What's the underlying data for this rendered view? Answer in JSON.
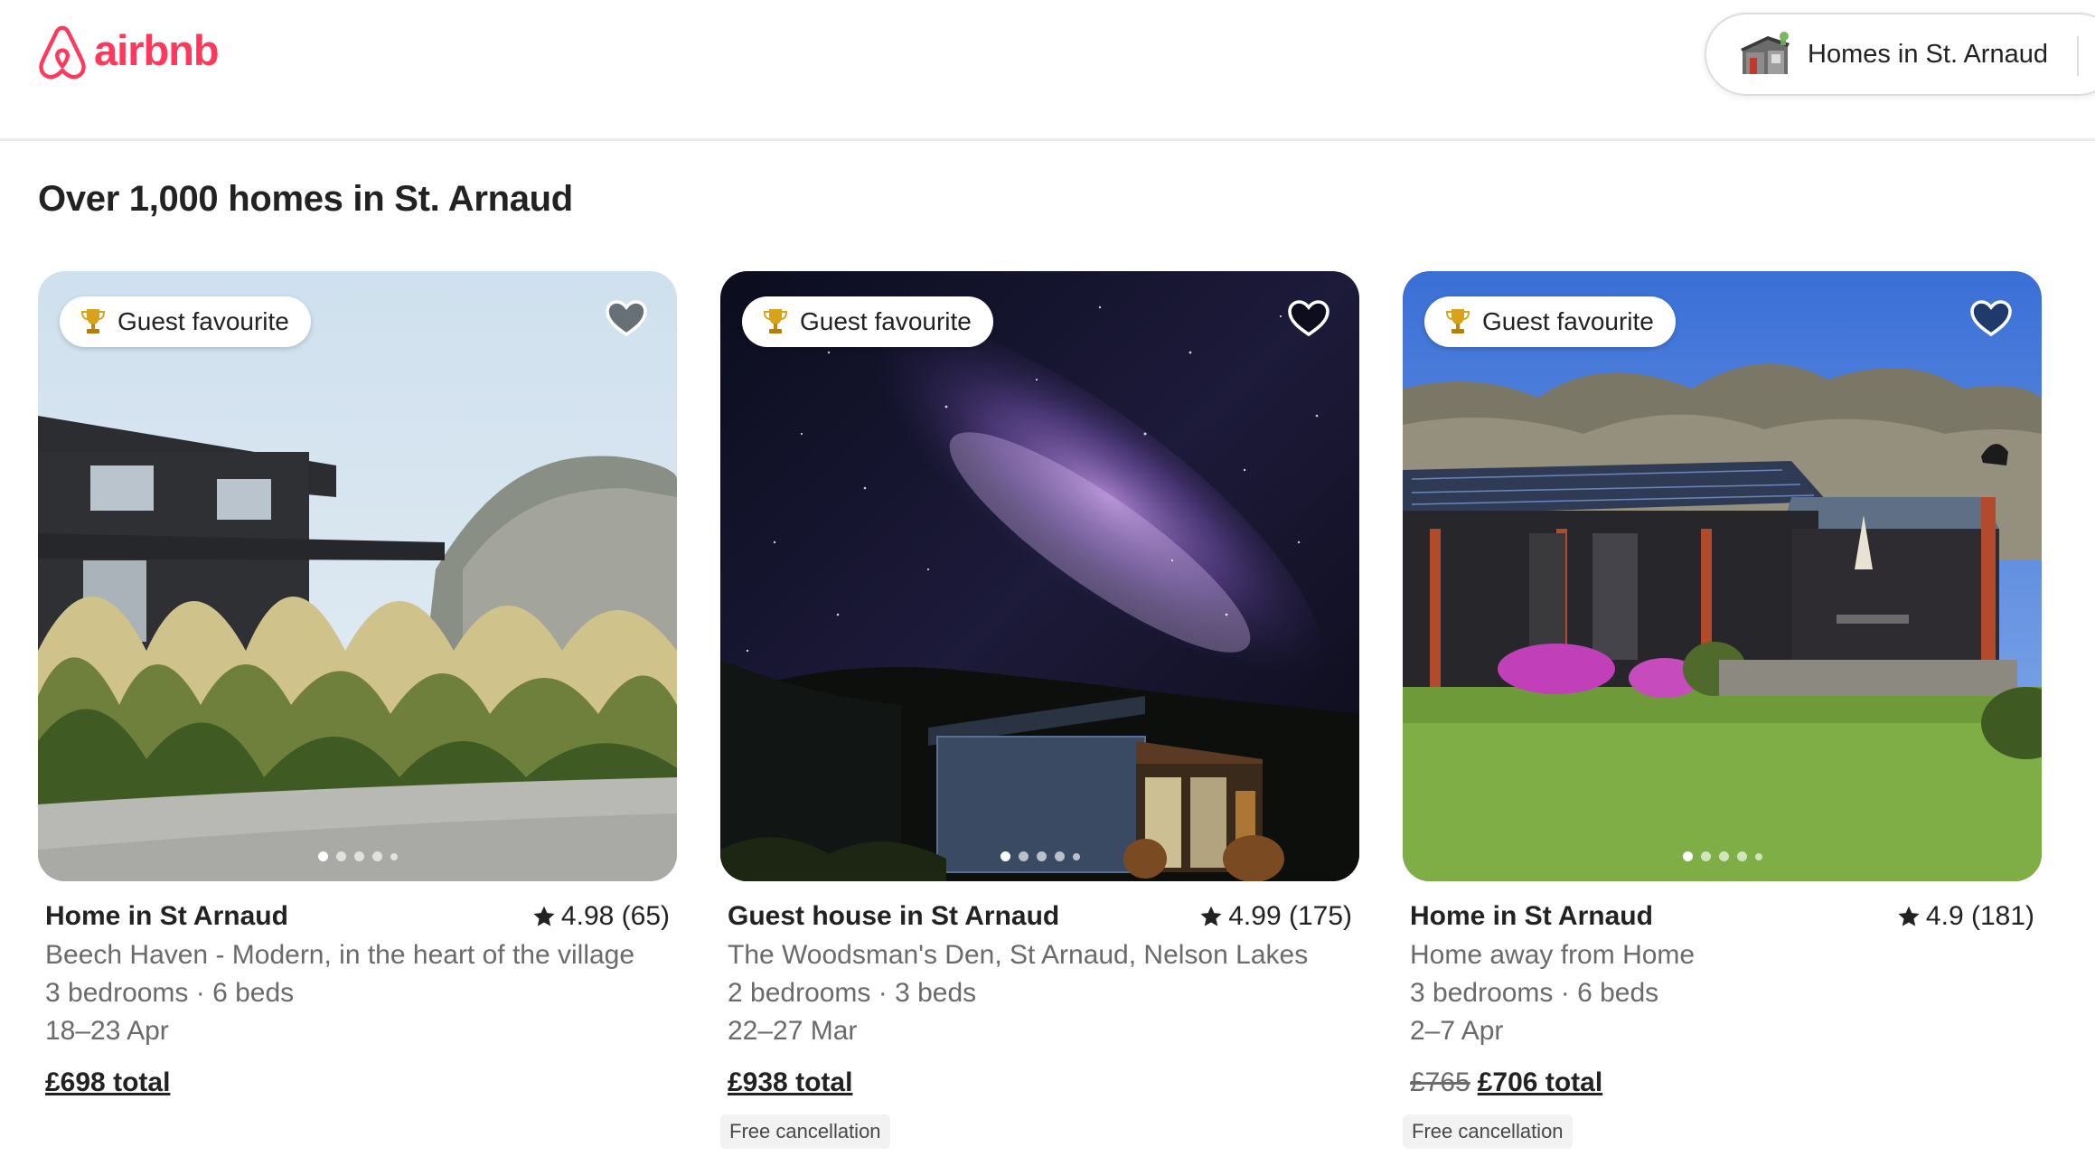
{
  "header": {
    "logo_text": "airbnb",
    "search_label": "Homes in St. Arnaud",
    "brand_color": "#ff385c"
  },
  "page_title": "Over 1,000 homes in St. Arnaud",
  "listings": [
    {
      "badge": "Guest favourite",
      "type": "Home in St Arnaud",
      "rating": "4.98 (65)",
      "title": "Beech Haven - Modern, in the heart of the village",
      "rooms": "3 bedrooms · 6 beds",
      "dates": "18–23 Apr",
      "price_old": "",
      "price_total": "£698 total",
      "free_cancellation": "",
      "photo_count": 5,
      "saved": false
    },
    {
      "badge": "Guest favourite",
      "type": "Guest house in St Arnaud",
      "rating": "4.99 (175)",
      "title": "The Woodsman's Den, St Arnaud, Nelson Lakes",
      "rooms": "2 bedrooms · 3 beds",
      "dates": "22–27 Mar",
      "price_old": "",
      "price_total": "£938 total",
      "free_cancellation": "Free cancellation",
      "photo_count": 5,
      "saved": false
    },
    {
      "badge": "Guest favourite",
      "type": "Home in St Arnaud",
      "rating": "4.9 (181)",
      "title": "Home away from Home",
      "rooms": "3 bedrooms · 6 beds",
      "dates": "2–7 Apr",
      "price_old": "£765",
      "price_total": "£706 total",
      "free_cancellation": "Free cancellation",
      "photo_count": 5,
      "saved": false
    }
  ]
}
